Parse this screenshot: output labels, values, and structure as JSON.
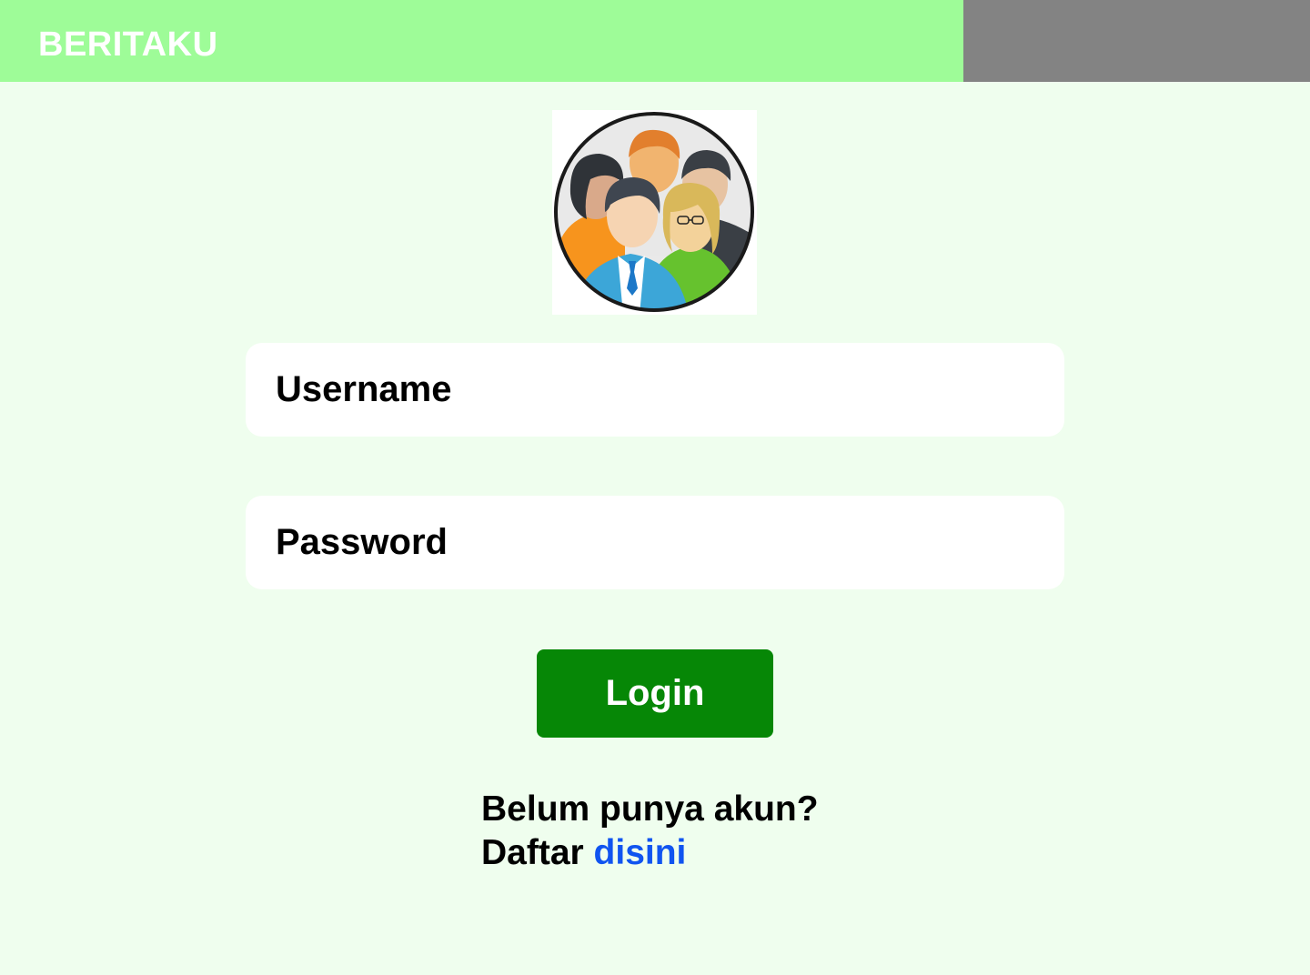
{
  "header": {
    "brand": "BERITAKU",
    "colors": {
      "bar": "#9efc98",
      "right_panel": "#838383",
      "background": "#effeee"
    }
  },
  "avatar": {
    "icon": "user-group-icon"
  },
  "form": {
    "username_placeholder": "Username",
    "password_placeholder": "Password",
    "login_label": "Login",
    "login_color": "#068706"
  },
  "register": {
    "question": "Belum punya akun?",
    "prefix": "Daftar",
    "link_text": "disini",
    "link_color": "#1054f0"
  }
}
